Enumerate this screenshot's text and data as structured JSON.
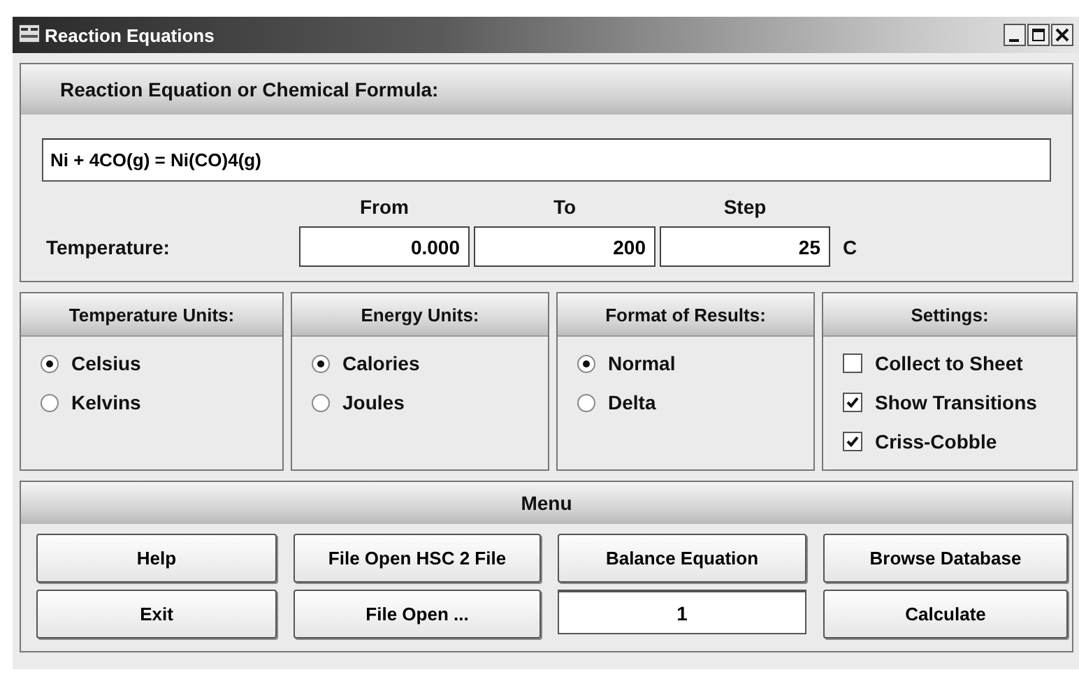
{
  "window": {
    "title": "Reaction Equations"
  },
  "equation": {
    "label": "Reaction Equation or Chemical Formula:",
    "value": "Ni + 4CO(g) = Ni(CO)4(g)"
  },
  "temperature": {
    "label": "Temperature:",
    "unit": "C",
    "fields": [
      {
        "heading": "From",
        "value": "0.000"
      },
      {
        "heading": "To",
        "value": "200"
      },
      {
        "heading": "Step",
        "value": "25"
      }
    ]
  },
  "groups": [
    {
      "title": "Temperature Units:",
      "options": [
        {
          "kind": "radio",
          "label": "Celsius",
          "selected": true
        },
        {
          "kind": "radio",
          "label": "Kelvins",
          "selected": false
        }
      ]
    },
    {
      "title": "Energy Units:",
      "options": [
        {
          "kind": "radio",
          "label": "Calories",
          "selected": true
        },
        {
          "kind": "radio",
          "label": "Joules",
          "selected": false
        }
      ]
    },
    {
      "title": "Format of Results:",
      "options": [
        {
          "kind": "radio",
          "label": "Normal",
          "selected": true
        },
        {
          "kind": "radio",
          "label": "Delta",
          "selected": false
        }
      ]
    },
    {
      "title": "Settings:",
      "options": [
        {
          "kind": "checkbox",
          "label": "Collect to Sheet",
          "checked": false
        },
        {
          "kind": "checkbox",
          "label": "Show Transitions",
          "checked": true
        },
        {
          "kind": "checkbox",
          "label": "Criss-Cobble",
          "checked": true
        }
      ]
    }
  ],
  "menu": {
    "title": "Menu",
    "items": [
      {
        "kind": "button",
        "label": "Help"
      },
      {
        "kind": "button",
        "label": "File Open HSC 2 File"
      },
      {
        "kind": "button",
        "label": "Balance Equation"
      },
      {
        "kind": "button",
        "label": "Browse Database"
      },
      {
        "kind": "button",
        "label": "Exit"
      },
      {
        "kind": "button",
        "label": "File Open ..."
      },
      {
        "kind": "field",
        "value": "1"
      },
      {
        "kind": "button",
        "label": "Calculate"
      }
    ]
  }
}
